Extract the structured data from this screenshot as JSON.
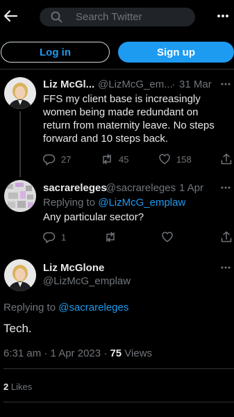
{
  "topbar": {
    "search_placeholder": "Search Twitter"
  },
  "auth": {
    "login_label": "Log in",
    "signup_label": "Sign up"
  },
  "tweet1": {
    "name": "Liz McGl...",
    "handle": "@LizMcG_em...",
    "sep": "·",
    "date": "31 Mar",
    "text": "FFS my client base is increasingly women being made redundant on return from maternity leave.  No steps forward and 10 steps back.",
    "replies": "27",
    "retweets": "45",
    "likes": "158"
  },
  "tweet2": {
    "name": "sacrareleges",
    "handle": "@sacrareleges",
    "sep": "·",
    "date": "1 Apr",
    "replying_label": "Replying to",
    "replying_to": "@LizMcG_emplaw",
    "text": "Any particular sector?",
    "replies": "1"
  },
  "main_tweet": {
    "name": "Liz McGlone",
    "handle": "@LizMcG_emplaw",
    "replying_label": "Replying to",
    "replying_to": "@sacrareleges",
    "text": "Tech.",
    "timestamp": "6:31 am · 1 Apr 2023 ·",
    "views_count": "75",
    "views_label": "Views",
    "likes_count": "2",
    "likes_label": "Likes"
  },
  "colors": {
    "accent": "#1d9bf0",
    "background": "#000000",
    "muted": "#71767b",
    "text": "#e7e9ea"
  }
}
